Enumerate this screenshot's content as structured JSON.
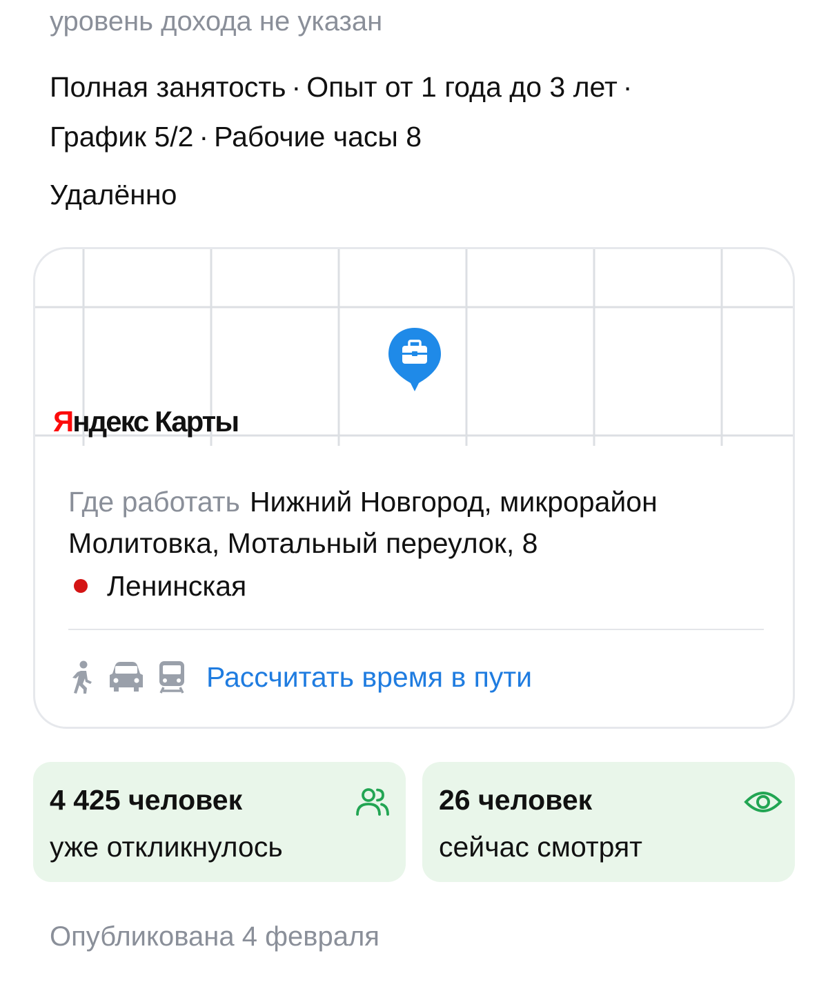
{
  "vacancy": {
    "salary_text": "уровень дохода не указан",
    "conditions": [
      "Полная занятость",
      "Опыт от 1 года до 3 лет",
      "График 5/2",
      "Рабочие часы 8"
    ],
    "separator": "·",
    "work_format": "Удалённо"
  },
  "map": {
    "logo_first_letter": "Я",
    "logo_rest": "ндекс Карты",
    "pin_icon": "briefcase-pin-icon",
    "pin_color": "#1f8ae8"
  },
  "address": {
    "label": "Где работать",
    "value": "Нижний Новгород, микрорайон Молитовка, Мотальный переулок, 8",
    "metro": "Ленинская",
    "metro_color": "#d41414"
  },
  "route": {
    "icons": [
      "walk-icon",
      "car-icon",
      "train-icon"
    ],
    "link": "Рассчитать время в пути",
    "link_color": "#1f7ce0"
  },
  "stats": [
    {
      "count": "4 425 человек",
      "label": "уже откликнулось",
      "icon": "people-icon"
    },
    {
      "count": "26 человек",
      "label": "сейчас смотрят",
      "icon": "eye-icon"
    }
  ],
  "stats_bg": "#e9f6ea",
  "published": "Опубликована 4 февраля"
}
